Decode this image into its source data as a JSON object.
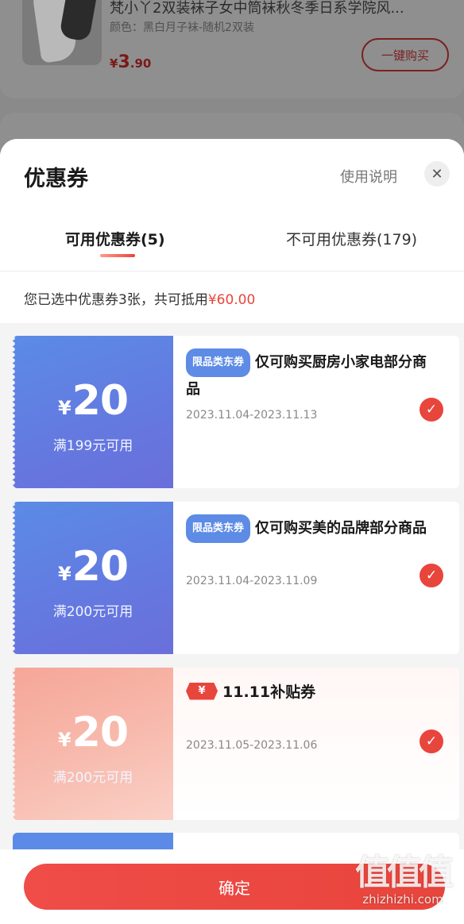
{
  "background_product": {
    "title": "梵小丫2双装袜子女中筒袜秋冬季日系学院风...",
    "sku": "颜色：黑白月子袜-随机2双装",
    "price_symbol": "¥",
    "price_int": "3",
    "price_dec": ".90",
    "buy_button": "一键购买"
  },
  "sheet": {
    "title": "优惠券",
    "usage_link": "使用说明",
    "close_icon": "close-icon",
    "tabs": [
      {
        "label": "可用优惠券(5)",
        "active": true
      },
      {
        "label": "不可用优惠券(179)",
        "active": false
      }
    ],
    "summary_prefix": "您已选中优惠券3张，共可抵用",
    "summary_amount": "¥60.00"
  },
  "coupons": [
    {
      "currency": "¥",
      "amount": "20",
      "condition": "满199元可用",
      "badge": "限品类东券",
      "description": "仅可购买厨房小家电部分商品",
      "date_range": "2023.11.04-2023.11.13",
      "selected": true
    },
    {
      "currency": "¥",
      "amount": "20",
      "condition": "满200元可用",
      "badge": "限品类东券",
      "description": "仅可购买美的品牌部分商品",
      "date_range": "2023.11.04-2023.11.09",
      "selected": true
    },
    {
      "currency": "¥",
      "amount": "20",
      "condition": "满200元可用",
      "tag_symbol": "¥",
      "title": "11.11补贴券",
      "date_range": "2023.11.05-2023.11.06",
      "selected": true
    }
  ],
  "footer": {
    "confirm_label": "确定"
  },
  "watermark": {
    "big": "值值值",
    "small": "zhizhizhi.com"
  },
  "colors": {
    "accent": "#e8453c",
    "coupon_blue": "#5b8be6",
    "coupon_pink": "#f6a697"
  }
}
